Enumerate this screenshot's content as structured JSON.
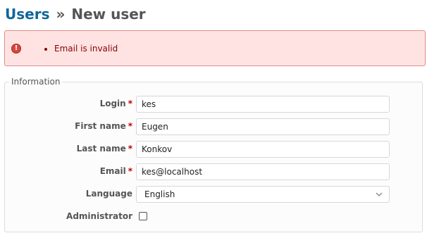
{
  "breadcrumb": {
    "parent": "Users",
    "separator": "»",
    "current": "New user"
  },
  "errors": {
    "icon": "error-icon",
    "icon_glyph": "!",
    "messages": [
      "Email is invalid"
    ]
  },
  "form": {
    "legend": "Information",
    "required_marker": "*",
    "fields": {
      "login": {
        "label": "Login",
        "value": "kes",
        "required": true
      },
      "firstname": {
        "label": "First name",
        "value": "Eugen",
        "required": true
      },
      "lastname": {
        "label": "Last name",
        "value": "Konkov",
        "required": true
      },
      "email": {
        "label": "Email",
        "value": "kes@localhost",
        "required": true
      },
      "language": {
        "label": "Language",
        "value": "English"
      },
      "admin": {
        "label": "Administrator",
        "checked": false
      }
    }
  },
  "colors": {
    "link": "#116699",
    "error_bg": "#ffe3e3",
    "error_border": "#e18a8a",
    "error_text": "#880000",
    "required": "#bb0000"
  }
}
